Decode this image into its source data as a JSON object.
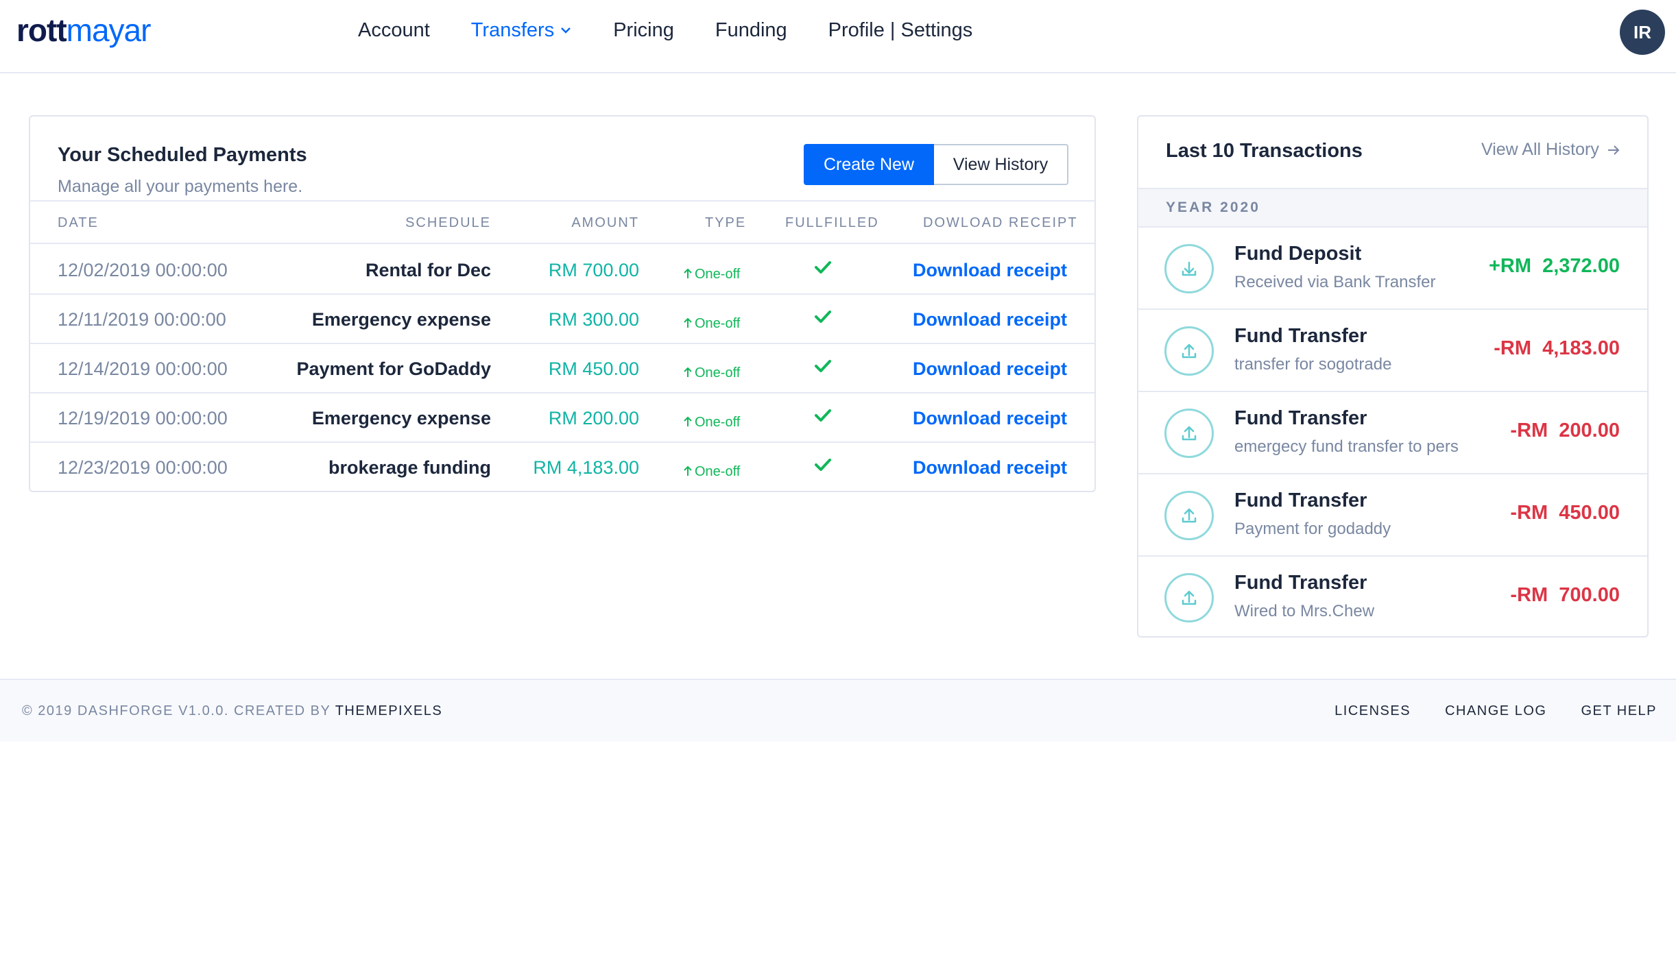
{
  "brand": {
    "part1": "rott",
    "part2": "mayar"
  },
  "nav": {
    "items": [
      {
        "label": "Account"
      },
      {
        "label": "Transfers"
      },
      {
        "label": "Pricing"
      },
      {
        "label": "Funding"
      },
      {
        "label": "Profile | Settings"
      }
    ],
    "active": "Transfers"
  },
  "user": {
    "initials": "IR"
  },
  "scheduled": {
    "title": "Your Scheduled Payments",
    "subtitle": "Manage all your payments here.",
    "create_label": "Create New",
    "history_label": "View History",
    "columns": [
      "DATE",
      "SCHEDULE",
      "AMOUNT",
      "TYPE",
      "FULLFILLED",
      "DOWLOAD RECEIPT"
    ],
    "rows": [
      {
        "date": "12/02/2019 00:00:00",
        "schedule": "Rental for Dec",
        "amount": "RM 700.00",
        "type": "One-off",
        "fulfilled": true,
        "receipt": "Download receipt"
      },
      {
        "date": "12/11/2019 00:00:00",
        "schedule": "Emergency expense",
        "amount": "RM 300.00",
        "type": "One-off",
        "fulfilled": true,
        "receipt": "Download receipt"
      },
      {
        "date": "12/14/2019 00:00:00",
        "schedule": "Payment for GoDaddy",
        "amount": "RM 450.00",
        "type": "One-off",
        "fulfilled": true,
        "receipt": "Download receipt"
      },
      {
        "date": "12/19/2019 00:00:00",
        "schedule": "Emergency expense",
        "amount": "RM 200.00",
        "type": "One-off",
        "fulfilled": true,
        "receipt": "Download receipt"
      },
      {
        "date": "12/23/2019 00:00:00",
        "schedule": "brokerage funding",
        "amount": "RM 4,183.00",
        "type": "One-off",
        "fulfilled": true,
        "receipt": "Download receipt"
      }
    ]
  },
  "transactions": {
    "title": "Last 10 Transactions",
    "view_all_label": "View All History",
    "year_label": "YEAR 2020",
    "items": [
      {
        "icon": "download-icon",
        "name": "Fund Deposit",
        "desc": "Received via Bank Transfer",
        "amount": "+RM  2,372.00",
        "direction": "in"
      },
      {
        "icon": "upload-icon",
        "name": "Fund Transfer",
        "desc": "transfer for sogotrade",
        "amount": "-RM  4,183.00",
        "direction": "out"
      },
      {
        "icon": "upload-icon",
        "name": "Fund Transfer",
        "desc": "emergecy fund transfer to pers",
        "amount": "-RM  200.00",
        "direction": "out"
      },
      {
        "icon": "upload-icon",
        "name": "Fund Transfer",
        "desc": "Payment for godaddy",
        "amount": "-RM  450.00",
        "direction": "out"
      },
      {
        "icon": "upload-icon",
        "name": "Fund Transfer",
        "desc": "Wired to Mrs.Chew",
        "amount": "-RM  700.00",
        "direction": "out"
      }
    ]
  },
  "footer": {
    "copyright": "© 2019 DASHFORGE V1.0.0. CREATED BY",
    "creator": "THEMEPIXELS",
    "links": [
      "LICENSES",
      "CHANGE LOG",
      "GET HELP"
    ]
  },
  "colors": {
    "primary": "#0168fa",
    "positive": "#10b759",
    "negative": "#dc3545",
    "amount": "#10b4a5",
    "muted": "#7987a1",
    "avatar": "#2b3f5c"
  }
}
